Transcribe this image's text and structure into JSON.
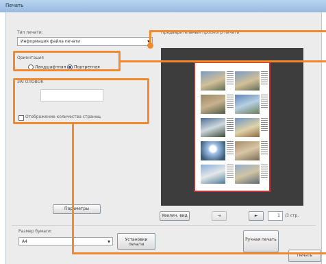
{
  "window": {
    "title": "Печать"
  },
  "print_type": {
    "label": "Тип печати:",
    "value": "Информация файла печати"
  },
  "preview": {
    "label": "Предварительный просмотр печати",
    "total_pages": "/3 стр.",
    "current_page": "1"
  },
  "orientation": {
    "label": "Ориентация",
    "landscape": "Ландшафтная",
    "portrait": "Портретная",
    "selected": "portrait"
  },
  "header": {
    "label": "ЗАГОЛОВОК",
    "value": ""
  },
  "page_count_checkbox": {
    "label": "Отображение количества страниц",
    "checked": false
  },
  "buttons": {
    "parameters": "Параметры",
    "zoom": "Увелич. вид",
    "print_setup": "Установки печати",
    "manual_print": "Ручная печать",
    "print": "Печать"
  },
  "paper_size": {
    "label": "Размер бумаги:",
    "value": "A4"
  },
  "colors": {
    "accent": "#f08a2c",
    "preview_bg": "#3d3d3d"
  }
}
